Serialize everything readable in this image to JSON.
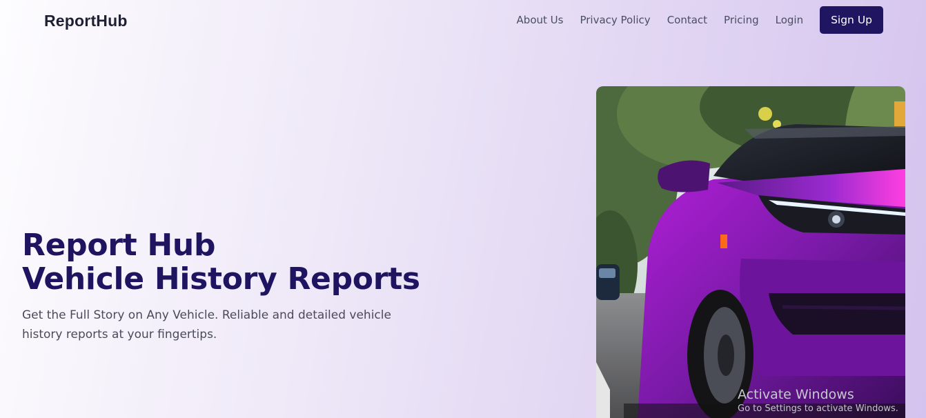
{
  "brand": {
    "name": "ReportHub"
  },
  "nav": {
    "links": [
      "About Us",
      "Privacy Policy",
      "Contact",
      "Pricing",
      "Login"
    ],
    "cta": "Sign Up"
  },
  "hero": {
    "title_line1": "Report Hub",
    "title_line2": "Vehicle History Reports",
    "subtitle": "Get the Full Story on Any Vehicle. Reliable and detailed vehicle history reports at your fingertips."
  },
  "watermark": {
    "title": "Activate Windows",
    "subtitle": "Go to Settings to activate Windows."
  },
  "colors": {
    "brand_dark": "#1e1460",
    "cta_bg": "#1f1560",
    "car_purple": "#7a1aa8"
  }
}
